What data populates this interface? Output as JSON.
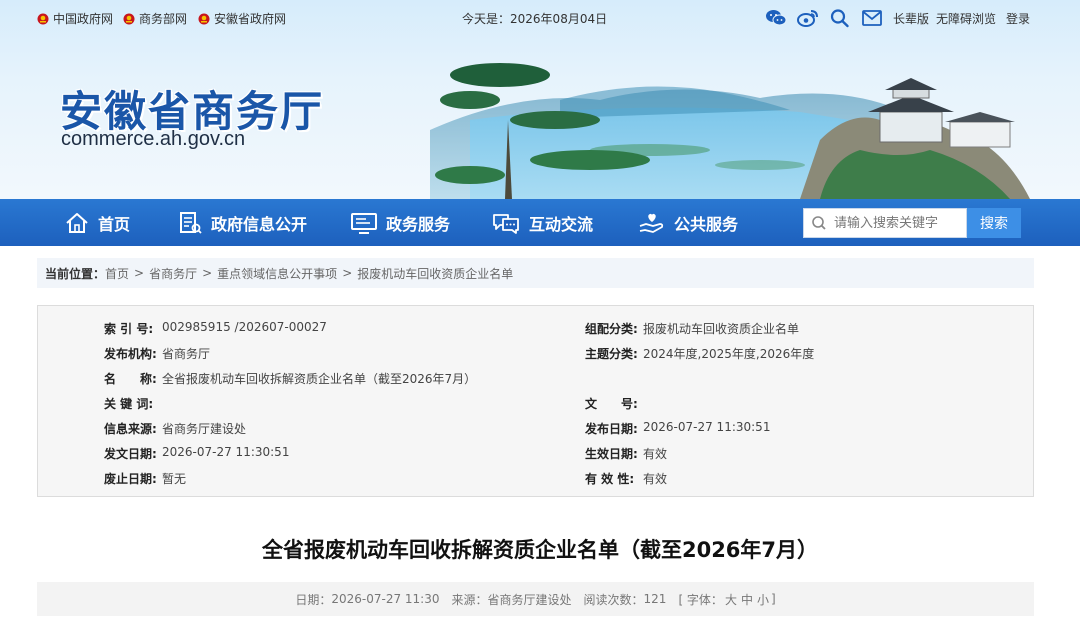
{
  "topbar": {
    "links": [
      {
        "label": "中国政府网"
      },
      {
        "label": "商务部网"
      },
      {
        "label": "安徽省政府网"
      }
    ],
    "date_prefix": "今天是：",
    "date": "2026年08月04日",
    "right_links": {
      "elder": "长辈版",
      "accessible": "无障碍浏览",
      "login": "登录"
    }
  },
  "header": {
    "site_name": "安徽省商务厅",
    "site_url": "commerce.ah.gov.cn"
  },
  "nav": {
    "items": [
      {
        "label": "首页",
        "icon": "home-icon"
      },
      {
        "label": "政府信息公开",
        "icon": "document-icon"
      },
      {
        "label": "政务服务",
        "icon": "monitor-icon"
      },
      {
        "label": "互动交流",
        "icon": "chat-icon"
      },
      {
        "label": "公共服务",
        "icon": "hand-heart-icon"
      }
    ],
    "search_placeholder": "请输入搜索关键字",
    "search_button": "搜索"
  },
  "breadcrumb": {
    "label": "当前位置：",
    "items": [
      "首页",
      "省商务厅",
      "重点领域信息公开事项",
      "报废机动车回收资质企业名单"
    ],
    "separator": ">"
  },
  "meta": {
    "index_no": {
      "label": "索 引 号:",
      "value": "002985915 /202607-00027"
    },
    "category": {
      "label": "组配分类:",
      "value": "报废机动车回收资质企业名单"
    },
    "publisher": {
      "label": "发布机构:",
      "value": "省商务厅"
    },
    "subject": {
      "label": "主题分类:",
      "value": "2024年度,2025年度,2026年度"
    },
    "name": {
      "label": "名　　称:",
      "value": "全省报废机动车回收拆解资质企业名单（截至2026年7月）"
    },
    "keywords": {
      "label": "关 键 词:",
      "value": ""
    },
    "doc_no": {
      "label": "文　　号:",
      "value": ""
    },
    "source": {
      "label": "信息来源:",
      "value": "省商务厅建设处"
    },
    "publish_date": {
      "label": "发布日期:",
      "value": "2026-07-27 11:30:51"
    },
    "issue_date": {
      "label": "发文日期:",
      "value": "2026-07-27 11:30:51"
    },
    "effective_date": {
      "label": "生效日期:",
      "value": "有效"
    },
    "expiry_date": {
      "label": "废止日期:",
      "value": "暂无"
    },
    "validity": {
      "label": "有 效 性:",
      "value": "有效"
    }
  },
  "article": {
    "title": "全省报废机动车回收拆解资质企业名单（截至2026年7月）",
    "date_label": "日期：",
    "date": "2026-07-27 11:30",
    "source_label": "来源：",
    "source": "省商务厅建设处",
    "views_label": "阅读次数：",
    "views": "121",
    "font_open": "[ 字体：",
    "font_large": "大",
    "font_medium": "中",
    "font_small": "小",
    "font_close": "]"
  },
  "colors": {
    "nav_blue": "#1d60bd",
    "title_blue": "#1a56a8",
    "search_button": "#3d8fe6"
  }
}
